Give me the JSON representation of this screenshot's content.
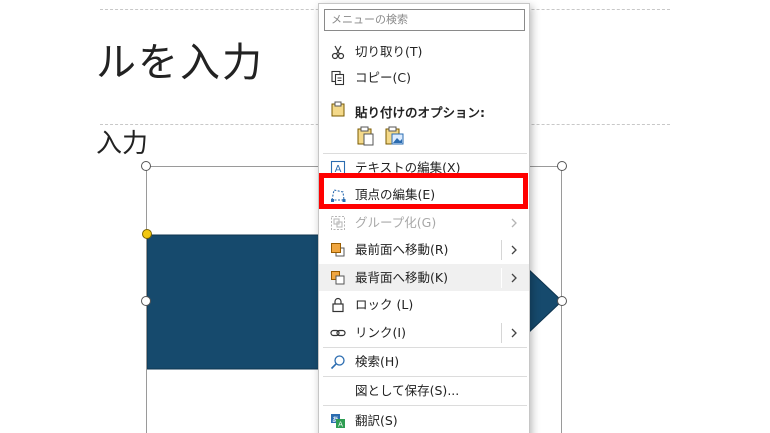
{
  "slide": {
    "title_text": "ルを入力",
    "subtitle_text": "入力",
    "shape_color": "#164a6d"
  },
  "menu": {
    "search_placeholder": "メニューの検索",
    "paste_options_label": "貼り付けのオプション:",
    "items": [
      {
        "label": "切り取り(T)",
        "icon": "scissors-icon"
      },
      {
        "label": "コピー(C)",
        "icon": "copy-icon"
      },
      {
        "label": "テキストの編集(X)",
        "icon": "text-edit-icon"
      },
      {
        "label": "頂点の編集(E)",
        "icon": "edit-points-icon"
      },
      {
        "label": "グループ化(G)",
        "icon": "group-icon",
        "disabled": true
      },
      {
        "label": "最前面へ移動(R)",
        "icon": "bring-front-icon"
      },
      {
        "label": "最背面へ移動(K)",
        "icon": "send-back-icon"
      },
      {
        "label": "ロック (L)",
        "icon": "lock-icon"
      },
      {
        "label": "リンク(I)",
        "icon": "link-icon"
      },
      {
        "label": "検索(H)",
        "icon": "search-icon"
      },
      {
        "label": "図として保存(S)...",
        "icon": ""
      },
      {
        "label": "翻訳(S)",
        "icon": "translate-icon"
      }
    ]
  },
  "colors": {
    "highlight": "#ff0000",
    "shape_fill": "#164a6d",
    "accent_icon": "#2b6cb0"
  }
}
